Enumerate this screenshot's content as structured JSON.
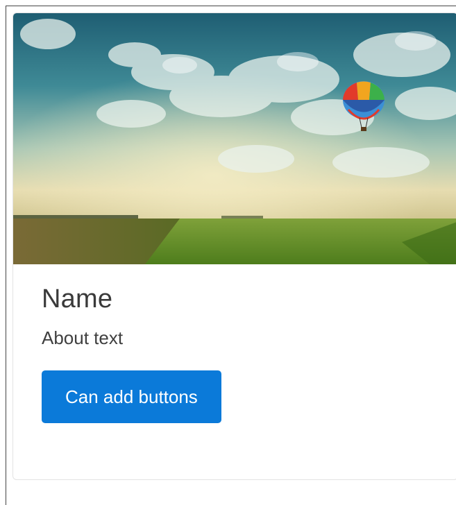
{
  "card": {
    "title": "Name",
    "text": "About text",
    "button_label": "Can add buttons",
    "image": {
      "subject": "landscape-with-hot-air-balloon",
      "colors": {
        "sky_top": "#1d6478",
        "sky_mid": "#7fb6b4",
        "horizon_glow": "#e8dfb4",
        "field": "#6b9a2c",
        "balloon": [
          "#e23b2a",
          "#f2a51f",
          "#3b8fd6",
          "#3cb04a"
        ]
      }
    },
    "button_color": "#0b7ad9"
  }
}
